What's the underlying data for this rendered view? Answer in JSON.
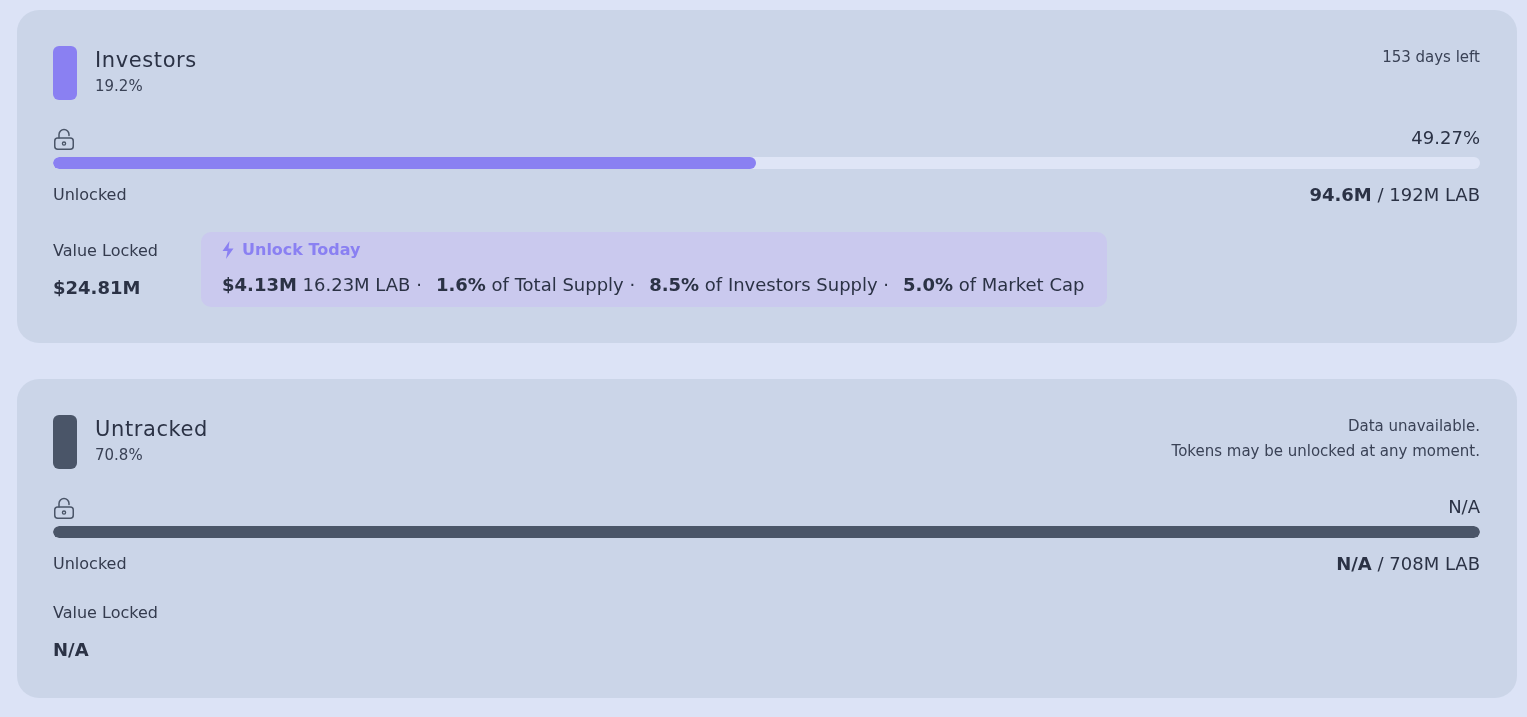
{
  "allocations": [
    {
      "name": "Investors",
      "share": "19.2%",
      "color": "#8a80f2",
      "notes": [
        "153 days left"
      ],
      "progress_reading": "49.27%",
      "level": 0.4927,
      "unlocked_label": "Unlocked",
      "unlocked_amount": "**94.6M** / 192M LAB",
      "value_locked_label": "Value Locked",
      "value_locked": "$24.81M",
      "unlock_today": {
        "title": "Unlock Today",
        "stats": [
          "**$4.13M** 16.23M LAB ·",
          "**1.6%** of Total Supply ·",
          "**8.5%** of Investors Supply ·",
          "**5.0%** of Market Cap"
        ]
      }
    },
    {
      "name": "Untracked",
      "share": "70.8%",
      "color": "#4a5568",
      "notes": [
        "Data unavailable.",
        "Tokens may be unlocked at any moment."
      ],
      "progress_reading": "N/A",
      "level": 1,
      "unlocked_label": "Unlocked",
      "unlocked_amount": "**N/A** / 708M LAB",
      "value_locked_label": "Value Locked",
      "value_locked": "N/A"
    }
  ]
}
